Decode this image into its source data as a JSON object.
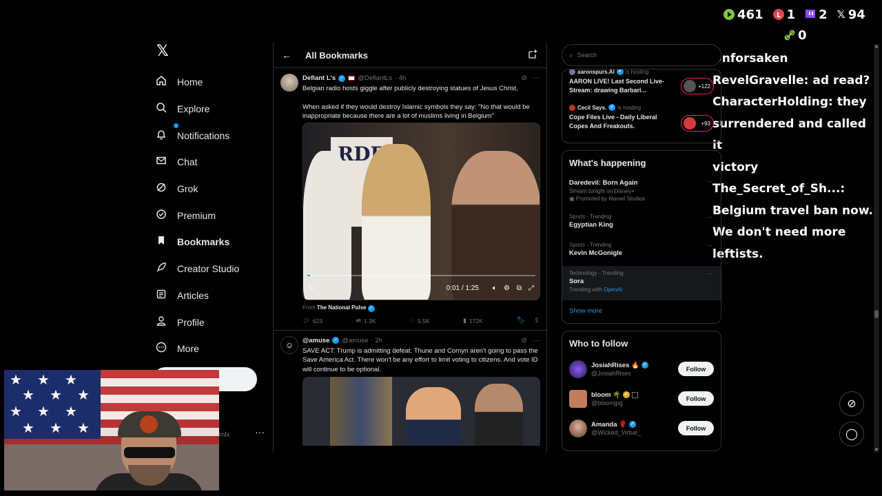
{
  "overlay": {
    "stats": [
      {
        "icon": "rumble-icon",
        "value": "461",
        "color": "#85c742"
      },
      {
        "icon": "locals-icon",
        "value": "1",
        "color": "#e0474b"
      },
      {
        "icon": "twitch-icon",
        "value": "2",
        "color": "#9146ff"
      },
      {
        "icon": "x-icon",
        "value": "94",
        "color": "#ffffff"
      }
    ],
    "link_stat": {
      "icon": "link-icon",
      "value": "0",
      "color": "#85c742"
    },
    "chat": [
      "Unforsaken",
      "RevelGravelle: ad read?",
      "CharacterHolding: they",
      "surrendered and called it",
      "victory",
      "The_Secret_of_Sh...:",
      "Belgium travel ban now.",
      "We don't need more",
      "leftists."
    ]
  },
  "nav": {
    "logo": "𝕏",
    "items": [
      {
        "label": "Home",
        "icon": "home-icon"
      },
      {
        "label": "Explore",
        "icon": "search-icon"
      },
      {
        "label": "Notifications",
        "icon": "bell-icon"
      },
      {
        "label": "Chat",
        "icon": "mail-icon"
      },
      {
        "label": "Grok",
        "icon": "grok-icon"
      },
      {
        "label": "Premium",
        "icon": "premium-icon"
      },
      {
        "label": "Bookmarks",
        "icon": "bookmark-icon"
      },
      {
        "label": "Creator Studio",
        "icon": "rocket-icon"
      },
      {
        "label": "Articles",
        "icon": "article-icon"
      },
      {
        "label": "Profile",
        "icon": "person-icon"
      },
      {
        "label": "More",
        "icon": "more-circle-icon"
      }
    ],
    "account_dots": "···",
    "account_handle_fragment": "mlx"
  },
  "main": {
    "title": "All Bookmarks",
    "tweets": [
      {
        "name": "Defiant L's",
        "handle": "@DefiantLs",
        "time": "· 4h",
        "text": [
          "Belgian radio hosts giggle after publicly destroying statues of Jesus Christ,",
          "When asked if they would destroy Islamic symbols they say: \"No that would be inappropriate because there are a lot of muslims living in Belgium\""
        ],
        "video": {
          "banner": "RDE",
          "time": "0:01 / 1:25",
          "progress": 0.013
        },
        "from_label": "From",
        "from_source": "The National Pulse",
        "replies": "623",
        "reposts": "1.3K",
        "likes": "5.5K",
        "views": "172K"
      },
      {
        "name": "@amuse",
        "handle": "@amuse",
        "time": "· 2h",
        "text": [
          "SAVE ACT: Trump is admitting defeat. Thune and Cornyn aren't going to pass the Save America Act. There won't be any effort to limit voting to citizens. And vote ID will continue to be optional."
        ]
      }
    ]
  },
  "right": {
    "search_placeholder": "Search",
    "live": [
      {
        "host": "aaronspurs.Al",
        "host_suffix": "is hosting",
        "title": "AARON LIVE! Last Second Live-Stream: drawing Barbari...",
        "count": "+122"
      },
      {
        "host": "Cecil Says.",
        "host_suffix": "is hosting",
        "title": "Cope Files Live - Daily Liberal Copes And Freakouts.",
        "count": "+93"
      }
    ],
    "happening_title": "What's happening",
    "trends": [
      {
        "meta": "",
        "name": "Daredevil: Born Again",
        "sub": "Stream tonight on Disney+",
        "promo": "Promoted by Marvel Studios"
      },
      {
        "meta": "Sports · Trending",
        "name": "Egyptian King",
        "sub": ""
      },
      {
        "meta": "Sports · Trending",
        "name": "Kevin McGonigle",
        "sub": ""
      },
      {
        "meta": "Technology · Trending",
        "name": "Sora",
        "sub": "Trending with",
        "link": "OpenAI"
      }
    ],
    "show_more": "Show more",
    "follow_title": "Who to follow",
    "follows": [
      {
        "name": "JosiahRises 🔥",
        "handle": "@JosiahRises",
        "button": "Follow"
      },
      {
        "name": "bloom 🌴",
        "handle": "@bloomjpg",
        "button": "Follow"
      },
      {
        "name": "Amanda 🌹",
        "handle": "@Wicked_Virtue_",
        "button": "Follow"
      }
    ]
  }
}
